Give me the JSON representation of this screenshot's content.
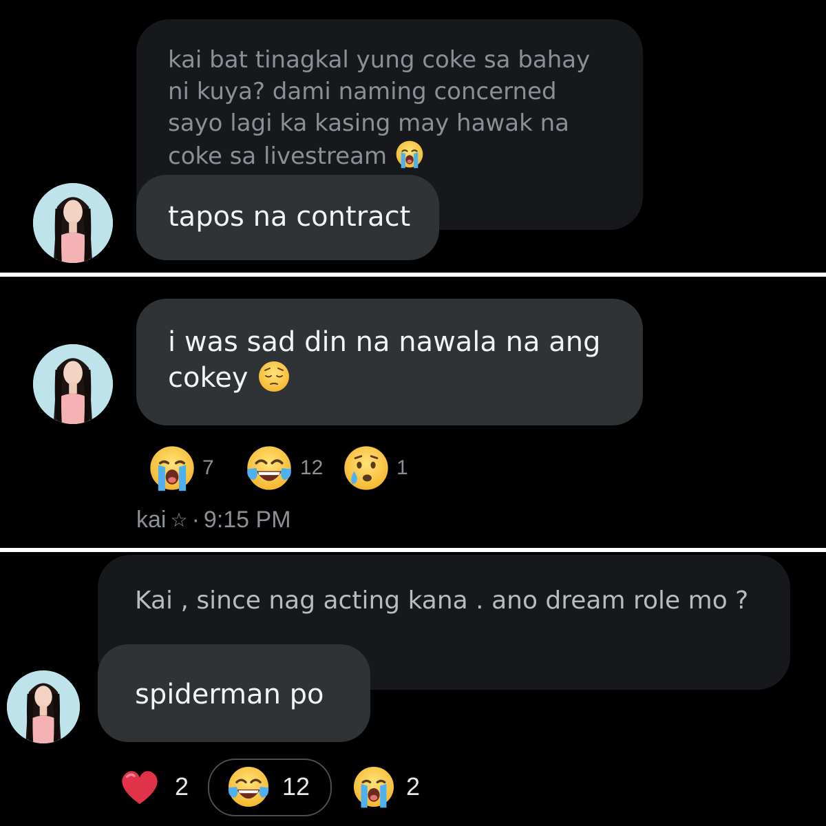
{
  "panel1": {
    "quoted_text": "kai bat tinagkal yung coke sa bahay ni kuya? dami naming concerned sayo lagi ka kasing may hawak na coke sa livestream",
    "quoted_emoji": "loudly-crying-face",
    "reply_text": "tapos na contract"
  },
  "panel2": {
    "reply_text": "i was sad din na nawala na ang cokey",
    "reply_emoji": "pensive-face",
    "reactions": [
      {
        "emoji": "loudly-crying-face",
        "count": "7"
      },
      {
        "emoji": "face-with-tears-of-joy",
        "count": "12"
      },
      {
        "emoji": "crying-face",
        "count": "1"
      }
    ],
    "author": "kai",
    "star": "☆",
    "separator": "·",
    "time": "9:15 PM"
  },
  "panel3": {
    "quoted_text": "Kai , since nag acting kana . ano dream role mo ?",
    "reply_text": "spiderman po",
    "reactions": [
      {
        "emoji": "red-heart",
        "count": "2",
        "selected": false
      },
      {
        "emoji": "face-with-tears-of-joy",
        "count": "12",
        "selected": true
      },
      {
        "emoji": "loudly-crying-face",
        "count": "2",
        "selected": false
      }
    ]
  },
  "colors": {
    "background": "#000000",
    "quoted_bubble": "#16181c",
    "reply_bubble": "#2f3336",
    "muted_text": "#8b9096",
    "divider": "#ffffff"
  }
}
